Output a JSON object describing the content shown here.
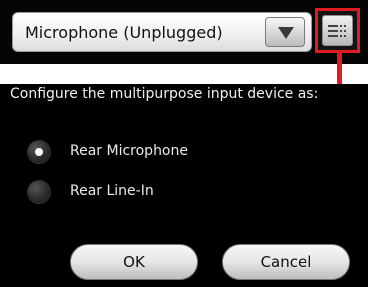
{
  "device_select": {
    "value": "Microphone (Unplugged)"
  },
  "dialog": {
    "prompt": "Configure the multipurpose input device as:",
    "options": [
      {
        "label": "Rear Microphone",
        "selected": true
      },
      {
        "label": "Rear Line-In",
        "selected": false
      }
    ],
    "ok_label": "OK",
    "cancel_label": "Cancel"
  },
  "colors": {
    "highlight": "#e11b22",
    "background": "#000000"
  },
  "icons": {
    "dropdown": "chevron-down-icon",
    "configure": "device-config-icon"
  }
}
